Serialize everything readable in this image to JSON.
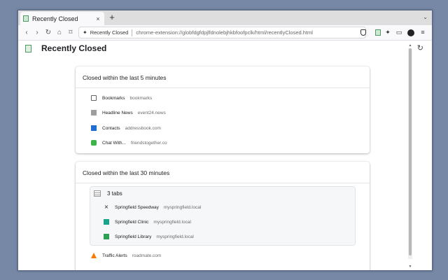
{
  "browser": {
    "tab": {
      "title": "Recently Closed",
      "close_glyph": "×"
    },
    "newtab_glyph": "+",
    "tabs_menu_glyph": "⌄",
    "nav": {
      "back": "‹",
      "forward": "›",
      "reload": "↻",
      "home": "⌂",
      "bookmark": "⌑"
    },
    "urlbar": {
      "extension_name": "Recently Closed",
      "url": "chrome-extension://globfdgfdpjlfdnolebjhkbfoofpclk/html/recentlyClosed.html"
    },
    "toolbar_icons": [
      "shield-icon",
      "extension-icon",
      "puzzle-icon",
      "sidebar-icon",
      "avatar-icon",
      "menu-icon"
    ],
    "menu_glyph": "≡",
    "puzzle_glyph": "✦",
    "sidebar_glyph": "▭"
  },
  "page": {
    "title": "Recently Closed",
    "refresh_glyph": "↻",
    "sections": [
      {
        "heading": "Closed within the last 5 minutes",
        "items": [
          {
            "title": "Bookmarks",
            "domain": "bookmarks",
            "icon": "bookmarks-icon"
          },
          {
            "title": "Headline News",
            "domain": "event24.news",
            "icon": "news-icon"
          },
          {
            "title": "Contacts",
            "domain": "addressbook.com",
            "icon": "contacts-icon"
          },
          {
            "title": "Chat With...",
            "domain": "friendstogether.co",
            "icon": "chat-icon"
          }
        ]
      },
      {
        "heading": "Closed within the last 30 minutes",
        "group": {
          "label": "3 tabs",
          "items": [
            {
              "title": "Springfield Speedway",
              "domain": "myspringfield.local",
              "icon": "speedway-icon"
            },
            {
              "title": "Springfield Clinic",
              "domain": "myspringfield.local",
              "icon": "clinic-icon"
            },
            {
              "title": "Springfield Library",
              "domain": "myspringfield.local",
              "icon": "library-icon"
            }
          ]
        },
        "items": [
          {
            "title": "Traffic Alerts",
            "domain": "roadmate.com",
            "icon": "traffic-cone-icon"
          }
        ]
      }
    ]
  },
  "colors": {
    "desktop": "#7688a6",
    "tabstrip": "#dedede",
    "contacts": "#1e6fd1",
    "chat": "#3bb54a",
    "clinic": "#19a38a",
    "library": "#2f9e57",
    "traffic": "#f57c00"
  }
}
